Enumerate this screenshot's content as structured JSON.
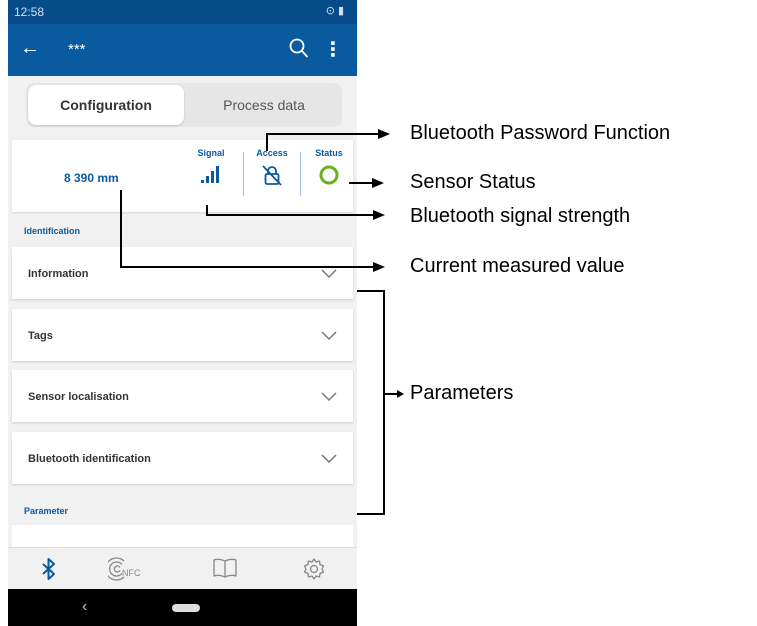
{
  "status_bar": {
    "time": "12:58"
  },
  "app_bar": {
    "title": "***"
  },
  "tabs": [
    {
      "label": "Configuration",
      "active": true
    },
    {
      "label": "Process data",
      "active": false
    }
  ],
  "overview": {
    "measured_value": "8 390 mm",
    "signal_label": "Signal",
    "access_label": "Access",
    "status_label": "Status",
    "status_color": "#6ab023",
    "accent_color": "#0a5aa0"
  },
  "sections": {
    "identification": "Identification",
    "parameter": "Parameter"
  },
  "panels": [
    {
      "label": "Information"
    },
    {
      "label": "Tags"
    },
    {
      "label": "Sensor localisation"
    },
    {
      "label": "Bluetooth identification"
    }
  ],
  "bottom_nav": {
    "nfc_label": "NFC",
    "icons": [
      "bluetooth-icon",
      "nfc-icon",
      "book-icon",
      "settings-gear-icon"
    ]
  },
  "callouts": {
    "password": "Bluetooth Password Function",
    "status": "Sensor Status",
    "signal": "Bluetooth signal strength",
    "value": "Current measured value",
    "parameters": "Parameters"
  }
}
